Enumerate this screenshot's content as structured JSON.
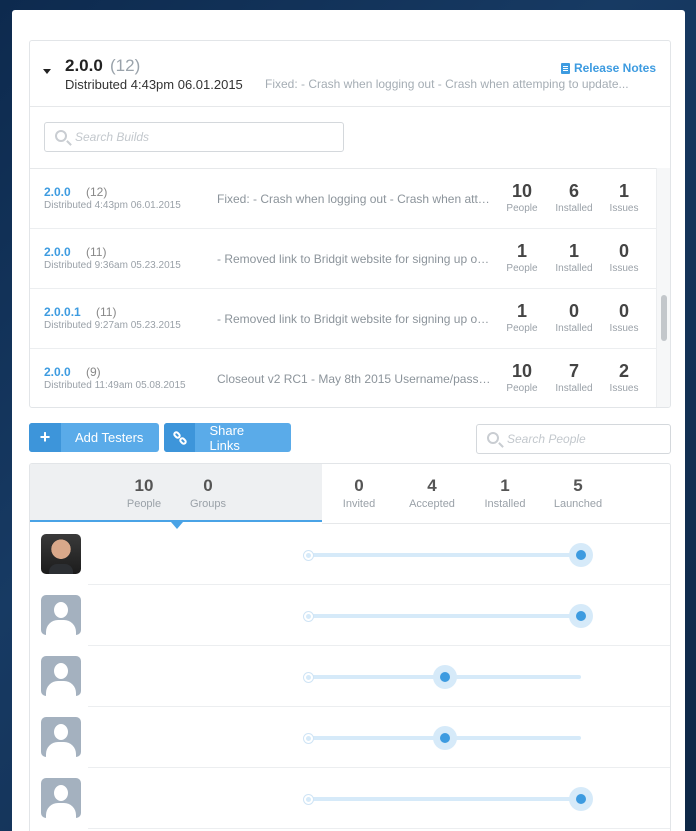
{
  "release": {
    "version": "2.0.0",
    "count": "(12)",
    "distributed": "Distributed 4:43pm 06.01.2015",
    "notes_link": "Release Notes",
    "notes_preview": "Fixed: - Crash when logging out - Crash when attemping to update..."
  },
  "builds_search": {
    "placeholder": "Search Builds"
  },
  "builds": [
    {
      "version": "2.0.0",
      "count": "(12)",
      "distributed": "Distributed 4:43pm 06.01.2015",
      "notes": "Fixed: - Crash when logging out - Crash when attemping to update",
      "people": "10",
      "installed": "6",
      "issues": "1"
    },
    {
      "version": "2.0.0",
      "count": "(11)",
      "distributed": "Distributed 9:36am 05.23.2015",
      "notes": "- Removed link to Bridgit website for signing up on login page",
      "people": "1",
      "installed": "1",
      "issues": "0"
    },
    {
      "version": "2.0.0.1",
      "count": "(11)",
      "distributed": "Distributed 9:27am 05.23.2015",
      "notes": "- Removed link to Bridgit website for signing up on login page",
      "people": "1",
      "installed": "0",
      "issues": "0"
    },
    {
      "version": "2.0.0",
      "count": "(9)",
      "distributed": "Distributed 11:49am 05.08.2015",
      "notes": "Closeout v2 RC1 - May 8th 2015 Username/password",
      "people": "10",
      "installed": "7",
      "issues": "2"
    }
  ],
  "stat_labels": {
    "people": "People",
    "installed": "Installed",
    "issues": "Issues"
  },
  "actions": {
    "add_testers": "Add Testers",
    "share_links": "Share Links"
  },
  "people_search": {
    "placeholder": "Search People"
  },
  "testers_summary": {
    "people": {
      "value": "10",
      "label": "People"
    },
    "groups": {
      "value": "0",
      "label": "Groups"
    },
    "invited": {
      "value": "0",
      "label": "Invited"
    },
    "accepted": {
      "value": "4",
      "label": "Accepted"
    },
    "installed": {
      "value": "1",
      "label": "Installed"
    },
    "launched": {
      "value": "5",
      "label": "Launched"
    }
  },
  "testers": [
    {
      "avatar": "photo",
      "progress_stage": 4
    },
    {
      "avatar": "default",
      "progress_stage": 4
    },
    {
      "avatar": "default",
      "progress_stage": 2
    },
    {
      "avatar": "default",
      "progress_stage": 2
    },
    {
      "avatar": "default",
      "progress_stage": 4
    }
  ],
  "progress_stages_total": 4,
  "colors": {
    "accent": "#3d9be0",
    "button": "#5aabe9",
    "track": "#d6eaf9"
  }
}
